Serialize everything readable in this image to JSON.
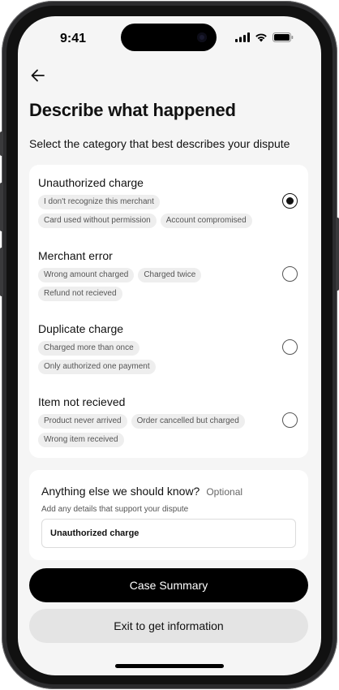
{
  "status": {
    "time": "9:41"
  },
  "header": {
    "title": "Describe what happened",
    "subtitle": "Select the category that best describes your dispute"
  },
  "options": [
    {
      "title": "Unauthorized charge",
      "selected": true,
      "chips": [
        "I don't recognize this merchant",
        "Card used without permission",
        "Account compromised"
      ]
    },
    {
      "title": "Merchant error",
      "selected": false,
      "chips": [
        "Wrong amount charged",
        "Charged twice",
        "Refund not recieved"
      ]
    },
    {
      "title": "Duplicate charge",
      "selected": false,
      "chips": [
        "Charged more than once",
        "Only authorized one payment"
      ]
    },
    {
      "title": "Item not recieved",
      "selected": false,
      "chips": [
        "Product never arrived",
        "Order cancelled but charged",
        "Wrong item received"
      ]
    }
  ],
  "extra": {
    "title": "Anything else we should know?",
    "optional": "Optional",
    "help": "Add any details that support your dispute",
    "value": "Unauthorized charge"
  },
  "buttons": {
    "primary": "Case Summary",
    "secondary": "Exit to get information"
  },
  "icons": {
    "back": "arrow-left-icon",
    "signal": "cellular-signal-icon",
    "wifi": "wifi-icon",
    "battery": "battery-icon"
  },
  "colors": {
    "primary_button": "#000000",
    "secondary_button": "#e4e4e4",
    "background": "#f5f5f5"
  }
}
